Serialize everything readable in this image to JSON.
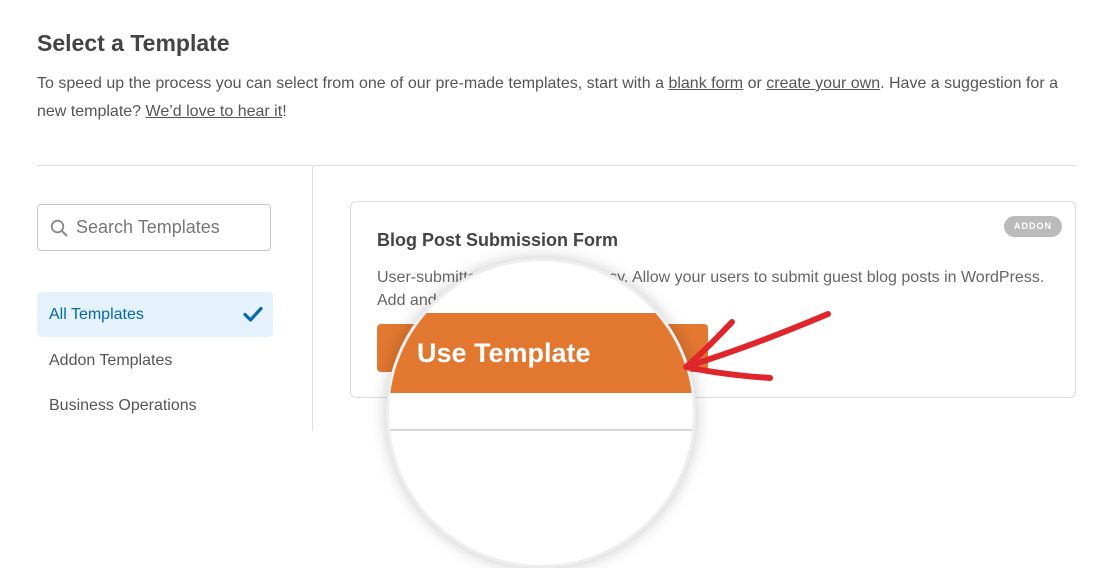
{
  "header": {
    "title": "Select a Template",
    "intro": {
      "text1": "To speed up the process you can select from one of our pre-made templates, start with a ",
      "link_blank": "blank form",
      "text2": " or ",
      "link_create": "create your own",
      "text3": ". Have a suggestion for a new template? ",
      "link_suggest": "We’d love to hear it",
      "text4": "!"
    }
  },
  "sidebar": {
    "search_placeholder": "Search Templates",
    "categories": [
      {
        "label": "All Templates",
        "active": true
      },
      {
        "label": "Addon Templates",
        "active": false
      },
      {
        "label": "Business Operations",
        "active": false
      }
    ]
  },
  "template_card": {
    "badge": "ADDON",
    "title": "Blog Post Submission Form",
    "description": "User-submitted content made easy. Allow your users to submit guest blog posts in WordPress. Add and remove fields as needed.",
    "button_label": "Use Template"
  },
  "colors": {
    "accent": "#e27730",
    "active_bg": "#e5f1fb",
    "active_text": "#036aab",
    "arrow": "#e0262a"
  },
  "icons": [
    "search-icon",
    "checkmark-icon",
    "arrow-icon"
  ]
}
